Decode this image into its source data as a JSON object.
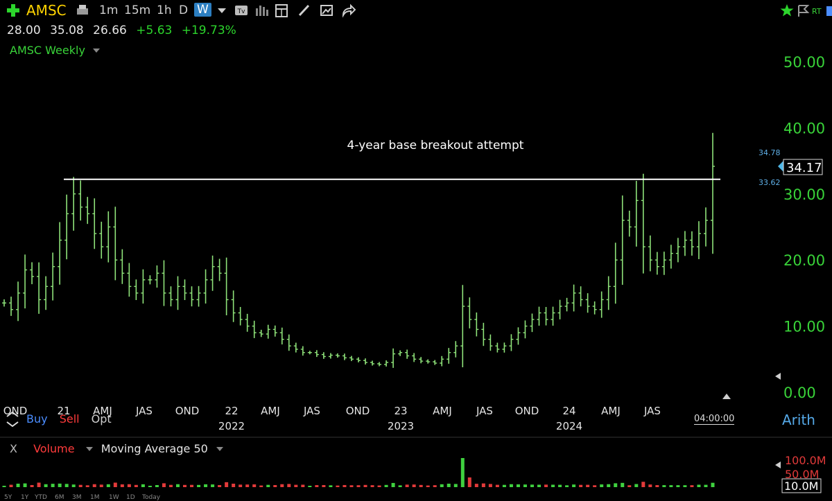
{
  "toolbar": {
    "symbol": "AMSC",
    "timeframes": [
      "1m",
      "15m",
      "1h",
      "D",
      "W"
    ],
    "active_timeframe": "W",
    "right_label": "RT"
  },
  "quote": {
    "open": "28.00",
    "high": "35.08",
    "low": "26.66",
    "change": "+5.63",
    "change_pct": "+19.73%"
  },
  "chart_title": "AMSC Weekly",
  "annotation": "4-year base breakout attempt",
  "resistance_level": 32.2,
  "price_tags": {
    "high": "34.78",
    "last": "34.17",
    "low": "33.62"
  },
  "trade_buttons": {
    "buy": "Buy",
    "sell": "Sell",
    "opt": "Opt"
  },
  "clock": "04:00:00",
  "scale_mode": "Arith",
  "volume_pane": {
    "close_label": "X",
    "title": "Volume",
    "indicator": "Moving Average 50",
    "axis_labels": [
      "100.0M",
      "50.0M",
      "10.0M"
    ]
  },
  "range_buttons": [
    "5Y",
    "1Y",
    "YTD",
    "6M",
    "3M",
    "1M",
    "1W",
    "1D",
    "Today"
  ],
  "colors": {
    "bar": "#8fe37a",
    "axis_text": "#39d339",
    "volume_up": "#3fd13f",
    "volume_down": "#e23a3a",
    "accent": "#2c7fc2"
  },
  "chart_data": {
    "type": "line",
    "title": "AMSC Weekly",
    "ylim": [
      0,
      50
    ],
    "y_ticks": [
      "50.00",
      "40.00",
      "30.00",
      "20.00",
      "10.00",
      "0.00"
    ],
    "x_tick_labels": [
      "OND",
      "21",
      "AMJ",
      "JAS",
      "OND",
      "22",
      "AMJ",
      "JAS",
      "OND",
      "23",
      "AMJ",
      "JAS",
      "OND",
      "24",
      "AMJ",
      "JAS"
    ],
    "year_labels": [
      "2022",
      "2023",
      "2024"
    ],
    "series": [
      {
        "values": [
          13.5,
          12.5,
          15,
          18.5,
          17.5,
          14,
          16,
          19,
          23,
          27,
          30,
          28,
          27,
          24,
          22,
          25,
          20,
          18,
          16,
          15,
          17,
          17,
          18,
          15,
          14,
          16,
          15,
          14,
          15,
          17,
          19,
          18,
          14,
          12,
          11,
          10,
          9,
          8.8,
          9.5,
          9,
          8,
          7,
          6.5,
          6,
          6,
          5.7,
          5.4,
          5.6,
          5.5,
          5.2,
          5,
          4.8,
          4.5,
          4.3,
          4.2,
          4.5,
          5.8,
          6,
          5.5,
          5,
          4.7,
          4.6,
          4.4,
          5,
          6,
          7,
          13,
          11,
          9.5,
          8,
          7,
          6.5,
          7,
          8,
          9,
          10,
          11,
          12,
          11,
          12,
          13,
          13.5,
          15,
          14,
          13,
          12.5,
          14,
          16,
          20,
          26,
          25,
          29,
          22,
          20,
          19,
          20,
          21,
          22,
          23,
          22,
          24,
          26,
          34.17
        ]
      }
    ],
    "extra_values": {
      "resistance": 32.2,
      "last": 34.17,
      "volume_axis_ticks": [
        100,
        50,
        10
      ]
    }
  }
}
